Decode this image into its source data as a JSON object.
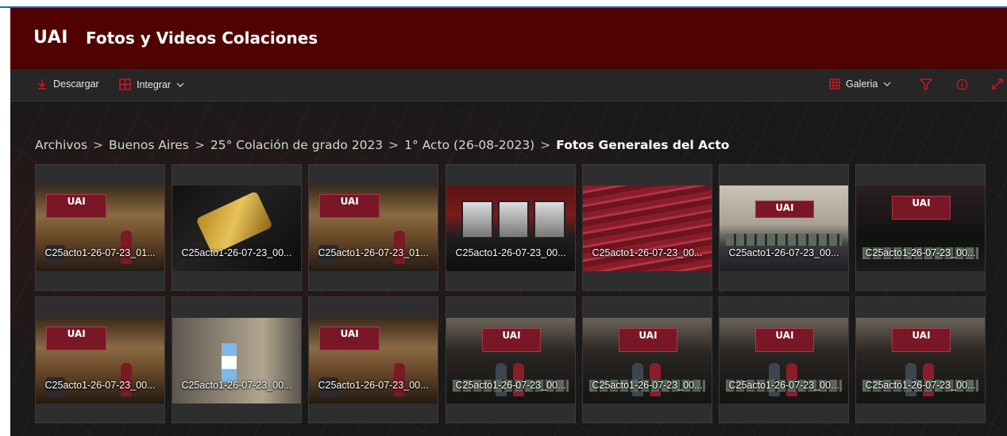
{
  "header": {
    "logo_text": "UAI",
    "site_title": "Fotos y Videos Colaciones",
    "background_color": "#500202"
  },
  "command_bar": {
    "download_label": "Descargar",
    "integrate_label": "Integrar",
    "view_label": "Galeria",
    "accent_color": "#e81123"
  },
  "breadcrumb": {
    "items": [
      "Archivos",
      "Buenos Aires",
      "25° Colación de grado 2023",
      "1° Acto (26-08-2023)"
    ],
    "current": "Fotos Generales del Acto",
    "separator": ">"
  },
  "gallery": {
    "tiles": [
      {
        "name": "C25acto1-26-07-23_01...",
        "scene": "stage"
      },
      {
        "name": "C25acto1-26-07-23_00...",
        "scene": "medal"
      },
      {
        "name": "C25acto1-26-07-23_01...",
        "scene": "stage"
      },
      {
        "name": "C25acto1-26-07-23_00...",
        "scene": "boxes"
      },
      {
        "name": "C25acto1-26-07-23_00...",
        "scene": "diplomas"
      },
      {
        "name": "C25acto1-26-07-23_00...",
        "scene": "hall"
      },
      {
        "name": "C25acto1-26-07-23_00...",
        "scene": "banner"
      },
      {
        "name": "C25acto1-26-07-23_00...",
        "scene": "stage"
      },
      {
        "name": "C25acto1-26-07-23_00...",
        "scene": "flag"
      },
      {
        "name": "C25acto1-26-07-23_00...",
        "scene": "stage"
      },
      {
        "name": "C25acto1-26-07-23_00...",
        "scene": "pair"
      },
      {
        "name": "C25acto1-26-07-23_00...",
        "scene": "pair"
      },
      {
        "name": "C25acto1-26-07-23_00...",
        "scene": "pair"
      },
      {
        "name": "C25acto1-26-07-23_00...",
        "scene": "pair"
      }
    ]
  }
}
